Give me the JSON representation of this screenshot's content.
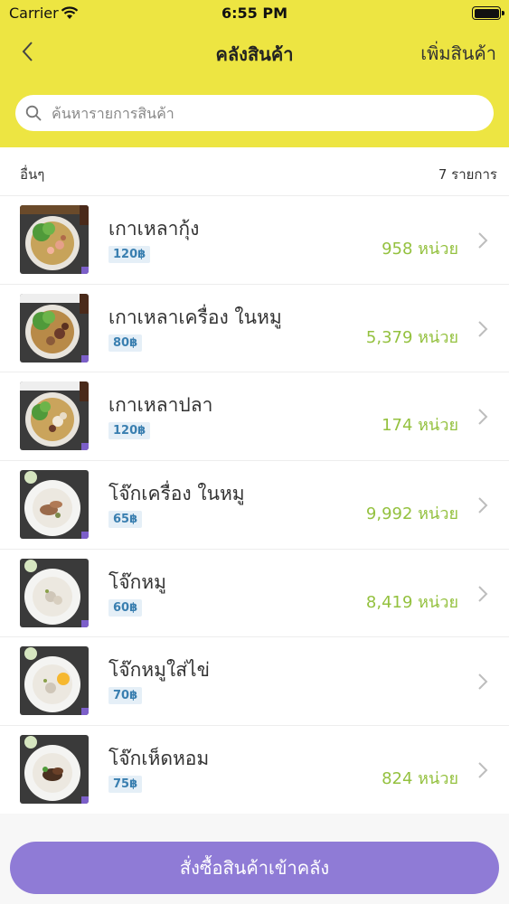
{
  "status_bar": {
    "carrier": "Carrier",
    "time": "6:55 PM"
  },
  "nav": {
    "title": "คลังสินค้า",
    "add_label": "เพิ่มสินค้า"
  },
  "search": {
    "placeholder": "ค้นหารายการสินค้า",
    "value": ""
  },
  "section": {
    "title": "อื่นๆ",
    "count": "7 รายการ"
  },
  "items": [
    {
      "name": "เกาเหลากุ้ง",
      "price": "120฿",
      "quantity": "958 หน่วย"
    },
    {
      "name": "เกาเหลาเครื่อง ในหมู",
      "price": "80฿",
      "quantity": "5,379 หน่วย"
    },
    {
      "name": "เกาเหลาปลา",
      "price": "120฿",
      "quantity": "174 หน่วย"
    },
    {
      "name": "โจ๊กเครื่อง ในหมู",
      "price": "65฿",
      "quantity": "9,992 หน่วย"
    },
    {
      "name": "โจ๊กหมู",
      "price": "60฿",
      "quantity": "8,419 หน่วย"
    },
    {
      "name": "โจ๊กหมูใส่ไข่",
      "price": "70฿",
      "quantity": ""
    },
    {
      "name": "โจ๊กเห็ดหอม",
      "price": "75฿",
      "quantity": "824 หน่วย"
    }
  ],
  "footer": {
    "order_button": "สั่งซื้อสินค้าเข้าคลัง"
  },
  "colors": {
    "header": "#ede542",
    "accent_purple": "#8f7bd6",
    "quantity_green": "#94c13f",
    "price_blue": "#3a7fb0"
  }
}
